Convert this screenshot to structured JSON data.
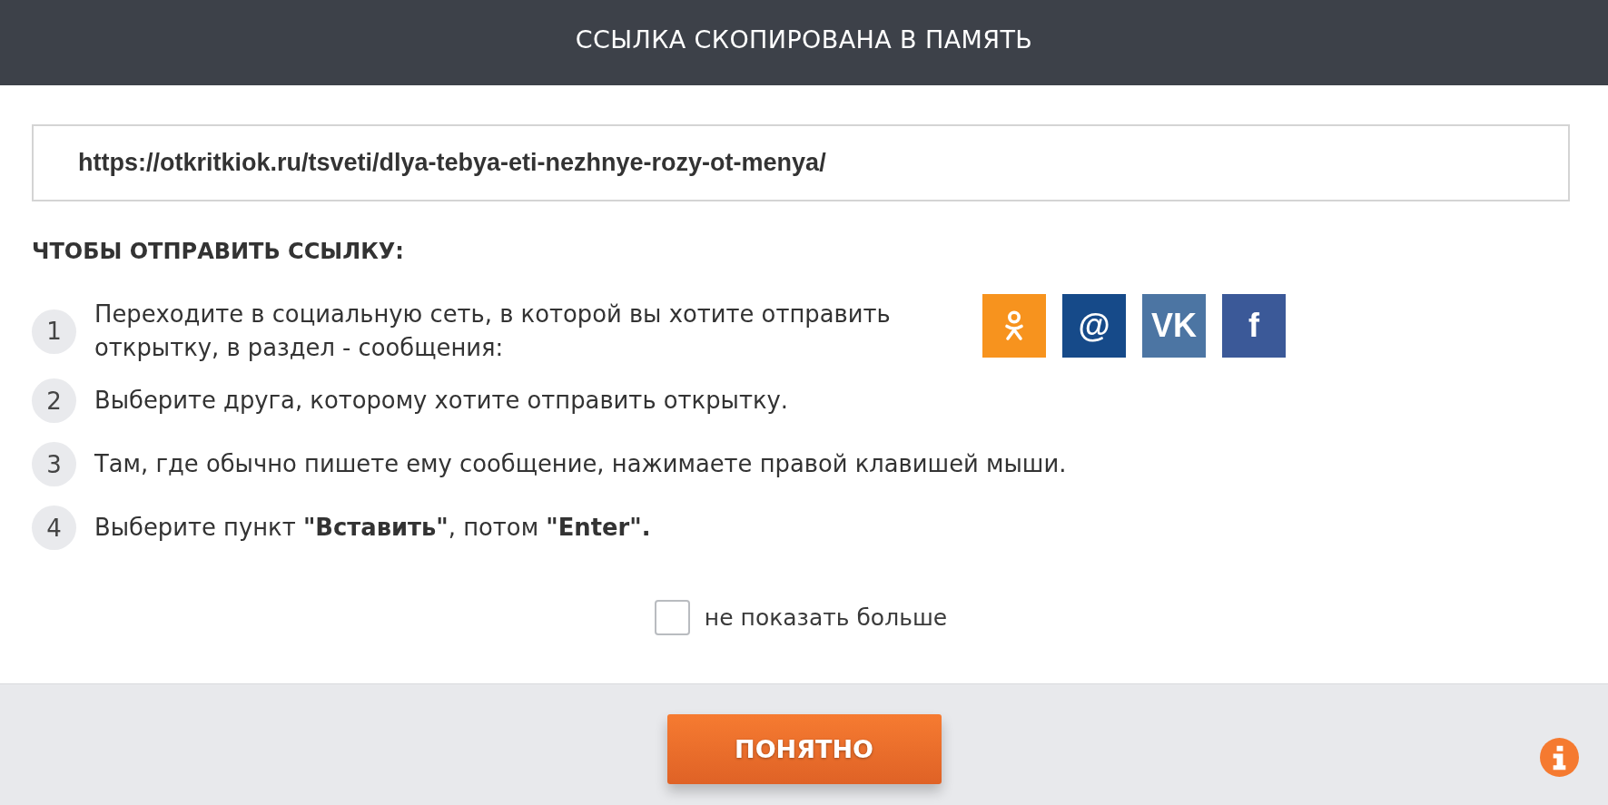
{
  "header": {
    "title": "ССЫЛКА СКОПИРОВАНА В ПАМЯТЬ"
  },
  "link_field": {
    "value": "https://otkritkiok.ru/tsveti/dlya-tebya-eti-nezhnye-rozy-ot-menya/"
  },
  "instructions": {
    "heading": "ЧТОБЫ ОТПРАВИТЬ ССЫЛКУ:",
    "steps": [
      {
        "number": "1",
        "text": "Переходите в социальную сеть, в которой вы хотите отправить открытку, в раздел - сообщения:"
      },
      {
        "number": "2",
        "text": "Выберите друга, которому хотите отправить открытку."
      },
      {
        "number": "3",
        "text": "Там, где обычно пишете ему сообщение, нажимаете правой клавишей мыши."
      },
      {
        "number": "4",
        "text": "Выберите пункт **\"Вставить\"**, потом **\"Enter\".**"
      }
    ]
  },
  "share_buttons": [
    {
      "kind": "figure",
      "color": "#f7931e"
    },
    {
      "kind": "glyph",
      "label": "@",
      "color": "#164a89"
    },
    {
      "kind": "glyph",
      "label": "VK",
      "color": "#4c75a3"
    },
    {
      "kind": "glyph",
      "label": "f",
      "color": "#3b5998"
    }
  ],
  "dont_show_again": {
    "label": "не показать больше",
    "checked": false
  },
  "footer": {
    "button": "ПОНЯТНО"
  }
}
